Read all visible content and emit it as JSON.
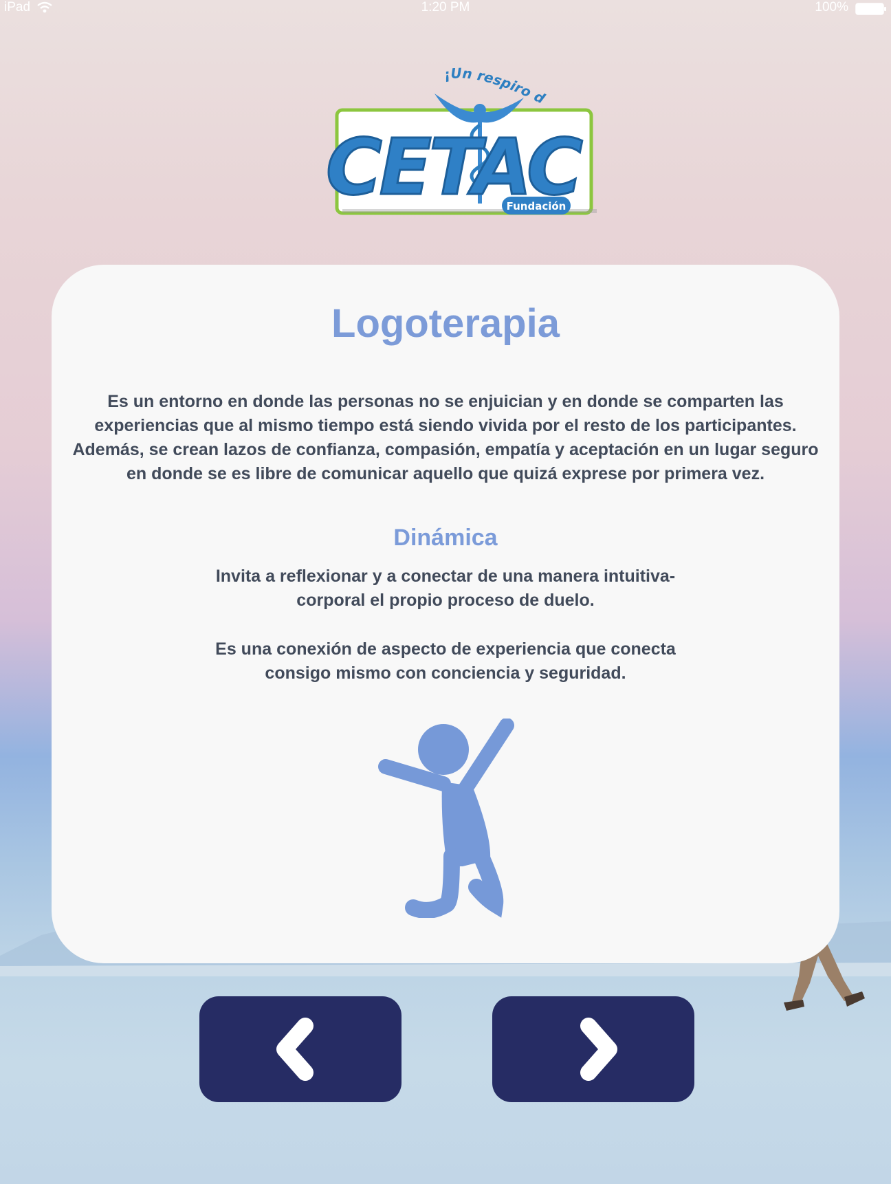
{
  "status_bar": {
    "device": "iPad",
    "time": "1:20 PM",
    "battery": "100%"
  },
  "logo": {
    "tagline": "¡Un respiro de vida!",
    "name": "CETAC",
    "badge": "Fundación"
  },
  "card": {
    "title": "Logoterapia",
    "intro_lines": [
      "Es un entorno en donde las personas no se enjuician y en donde se comparten las",
      "experiencias que al mismo tiempo está siendo vivida por el resto de los participantes.",
      "Además, se crean lazos de confianza, compasión, empatía y aceptación en un lugar seguro",
      "en donde se es libre de comunicar aquello que quizá exprese por primera vez."
    ],
    "subtitle": "Dinámica",
    "dynamic_1": [
      "Invita a reflexionar y a conectar de una manera intuitiva-",
      "corporal el propio proceso de duelo."
    ],
    "dynamic_2": [
      "Es una conexión de aspecto de experiencia que conecta",
      "consigo mismo con conciencia y seguridad."
    ],
    "figure_icon": "jumping-person-icon"
  },
  "nav": {
    "prev_icon": "chevron-left-icon",
    "next_icon": "chevron-right-icon"
  },
  "colors": {
    "accent": "#7b9bd9",
    "button": "#262c64",
    "card": "#f8f8f8",
    "text": "#414a5a"
  }
}
